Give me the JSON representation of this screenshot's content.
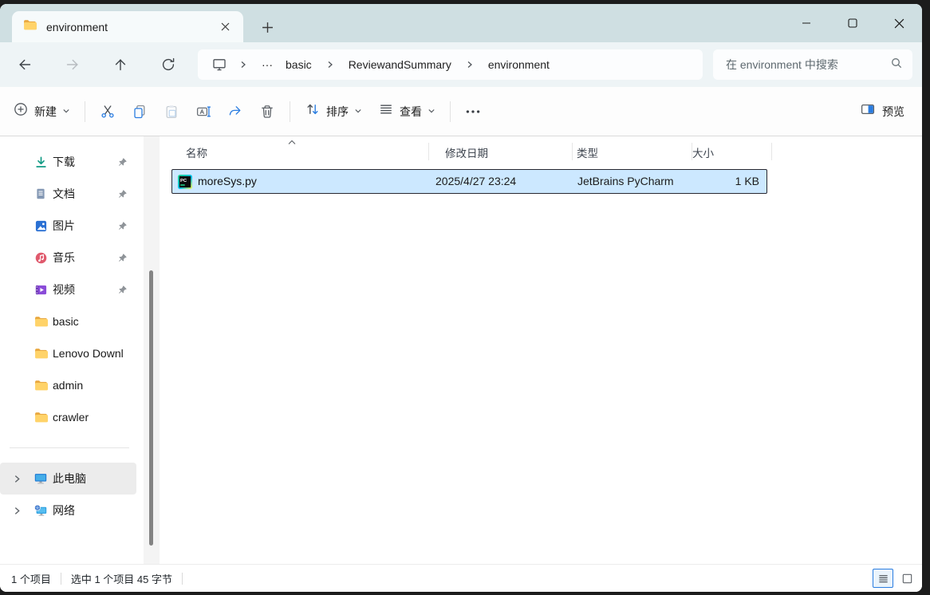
{
  "titlebar": {
    "tab_title": "environment"
  },
  "navbar": {
    "breadcrumb": {
      "overflow": "···",
      "items": [
        "basic",
        "ReviewandSummary",
        "environment"
      ]
    },
    "search": {
      "placeholder": "在 environment 中搜索"
    }
  },
  "toolbar": {
    "new_label": "新建",
    "sort_label": "排序",
    "view_label": "查看",
    "preview_label": "预览"
  },
  "sidebar": {
    "pinned": [
      {
        "label": "下载",
        "icon": "download"
      },
      {
        "label": "文档",
        "icon": "document"
      },
      {
        "label": "图片",
        "icon": "pictures"
      },
      {
        "label": "音乐",
        "icon": "music"
      },
      {
        "label": "视频",
        "icon": "videos"
      }
    ],
    "folders": [
      {
        "label": "basic"
      },
      {
        "label": "Lenovo Downl"
      },
      {
        "label": "admin"
      },
      {
        "label": "crawler"
      }
    ],
    "tree": [
      {
        "label": "此电脑",
        "selected": true
      },
      {
        "label": "网络",
        "selected": false
      }
    ]
  },
  "filelist": {
    "columns": [
      {
        "label": "名称"
      },
      {
        "label": "修改日期"
      },
      {
        "label": "类型"
      },
      {
        "label": "大小"
      }
    ],
    "rows": [
      {
        "name": "moreSys.py",
        "modified": "2025/4/27 23:24",
        "type": "JetBrains PyCharm",
        "size": "1 KB"
      }
    ]
  },
  "statusbar": {
    "count": "1 个项目",
    "selection": "选中 1 个项目  45 字节"
  },
  "colors": {
    "accent": "#2a7de1",
    "selection_bg": "#cce8ff",
    "tabbar_bg": "#cfdfe2"
  }
}
